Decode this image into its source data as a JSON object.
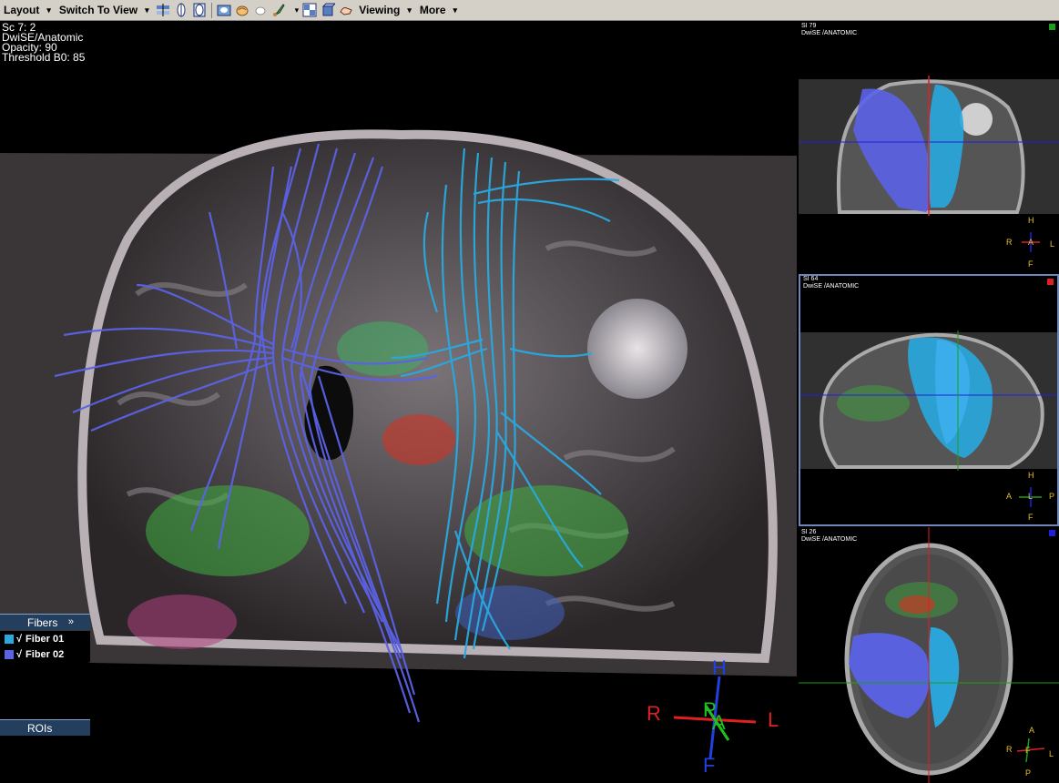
{
  "toolbar": {
    "layout_label": "Layout",
    "switch_label": "Switch To View",
    "viewing_label": "Viewing",
    "more_label": "More",
    "icons": [
      "views-icon",
      "sagittal-view-icon",
      "coronal-view-icon",
      "3d-view-icon",
      "brain-icon",
      "hand-icon",
      "brush-icon",
      "grid-layout-icon",
      "volume-icon",
      "pointer-hand-icon"
    ]
  },
  "main_view": {
    "overlay": {
      "line1": "Sc 7: 2",
      "line2": "DwiSE/Anatomic",
      "line3": "Opacity: 90",
      "line4": "Threshold B0: 85"
    },
    "orientation": {
      "top": "H",
      "bottom": "F",
      "left": "R",
      "right": "L",
      "front": "A",
      "back": "P"
    }
  },
  "fibers_panel": {
    "title": "Fibers",
    "expand_symbol": "»",
    "items": [
      {
        "check": "√",
        "label": "Fiber 01",
        "color": "#29a9e0"
      },
      {
        "check": "√",
        "label": "Fiber 02",
        "color": "#5b62e6"
      }
    ]
  },
  "rois_panel": {
    "title": "ROIs"
  },
  "side_views": [
    {
      "slice_label": "SI 79",
      "series_label": "DwiSE  /ANATOMIC",
      "marker_color": "#1aa01a",
      "orientation": {
        "top": "H",
        "bottom": "F",
        "left": "R",
        "right": "L",
        "center": "A"
      }
    },
    {
      "slice_label": "SI 64",
      "series_label": "DwiSE  /ANATOMIC",
      "marker_color": "#e02020",
      "orientation": {
        "top": "H",
        "bottom": "F",
        "left": "A",
        "right": "P",
        "center": "L"
      }
    },
    {
      "slice_label": "SI 26",
      "series_label": "DwiSE  /ANATOMIC",
      "marker_color": "#2020e0",
      "orientation": {
        "top": "A",
        "bottom": "P",
        "left": "R",
        "right": "L",
        "center": "F"
      }
    }
  ],
  "colors": {
    "fiber_01": "#29a9e0",
    "fiber_02": "#5b62e6",
    "panel_header": "#243e5e",
    "toolbar_bg": "#d4d0c8",
    "axis_red": "#e02020",
    "axis_blue": "#2040e0",
    "axis_green": "#20c020"
  }
}
